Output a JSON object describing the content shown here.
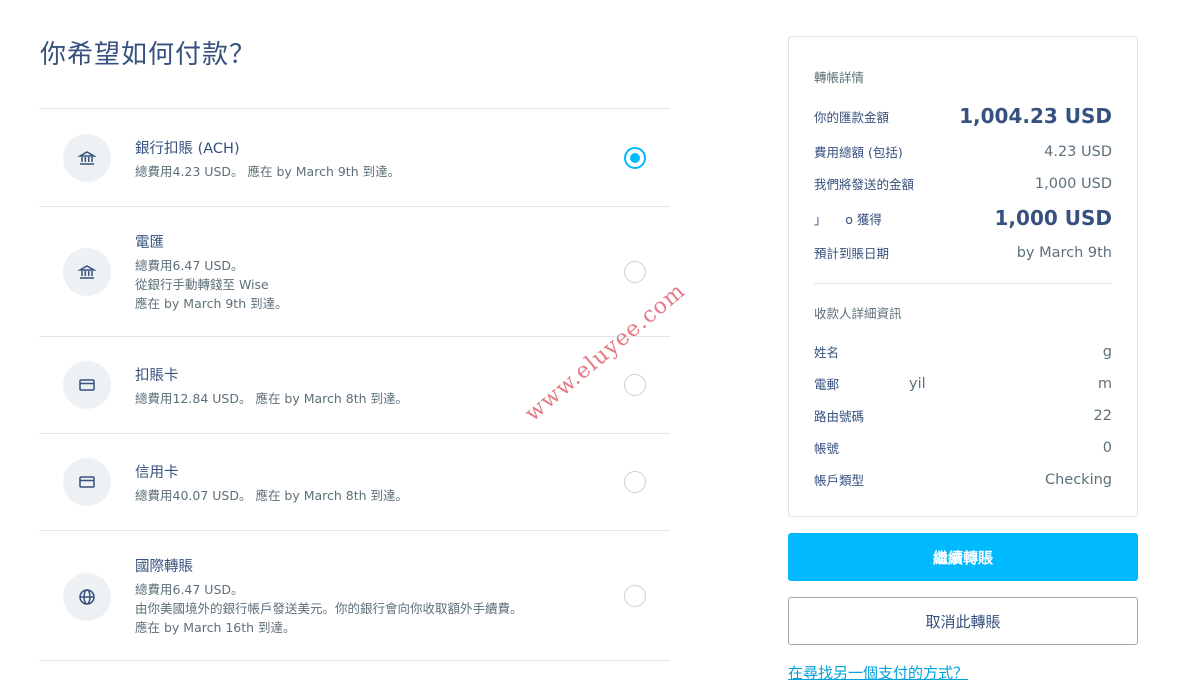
{
  "page_title": "你希望如何付款？",
  "payment_methods": [
    {
      "title": "銀行扣賬 (ACH)",
      "lines": [
        "總費用4.23 USD。 應在 by March 9th 到達。"
      ],
      "icon": "bank-icon",
      "selected": true
    },
    {
      "title": "電匯",
      "lines": [
        "總費用6.47 USD。",
        "從銀行手動轉錢至 Wise",
        "應在 by March 9th 到達。"
      ],
      "icon": "bank-icon",
      "selected": false
    },
    {
      "title": "扣賬卡",
      "lines": [
        "總費用12.84 USD。 應在 by March 8th 到達。"
      ],
      "icon": "card-icon",
      "selected": false
    },
    {
      "title": "信用卡",
      "lines": [
        "總費用40.07 USD。 應在 by March 8th 到達。"
      ],
      "icon": "card-icon",
      "selected": false
    },
    {
      "title": "國際轉賬",
      "lines": [
        "總費用6.47 USD。",
        "由你美國境外的銀行帳戶發送美元。你的銀行會向你收取額外手續費。",
        "應在 by March 16th 到達。"
      ],
      "icon": "globe-icon",
      "selected": false
    }
  ],
  "watermark": "www.eluyee.com",
  "summary": {
    "heading": "轉帳詳情",
    "rows": [
      {
        "label": "你的匯款金額",
        "value": "1,004.23 USD",
        "emphasis": true
      },
      {
        "label": "費用總額 (包括)",
        "value": "4.23 USD",
        "emphasis": false
      },
      {
        "label": "我們將發送的金額",
        "value": "1,000 USD",
        "emphasis": false
      },
      {
        "label": "」　　o 獲得",
        "value": "1,000 USD",
        "emphasis": true
      },
      {
        "label": "預計到賬日期",
        "value": "by March 9th",
        "emphasis": false
      }
    ],
    "recipient_heading": "收款人詳細資訊",
    "recipient_rows": [
      {
        "label": "姓名",
        "value": "g"
      },
      {
        "label": "電郵",
        "mid": "yil",
        "value": "m"
      },
      {
        "label": "路由號碼",
        "value": "22"
      },
      {
        "label": "帳號",
        "value": "0"
      },
      {
        "label": "帳戶類型",
        "value": "Checking"
      }
    ]
  },
  "actions": {
    "continue_label": "繼續轉賬",
    "cancel_label": "取消此轉賬",
    "other_method_link": "在尋找另一個支付的方式？"
  },
  "colors": {
    "accent": "#00b9ff",
    "text_primary": "#37517e",
    "text_secondary": "#5d7079",
    "link": "#00a2dd"
  }
}
